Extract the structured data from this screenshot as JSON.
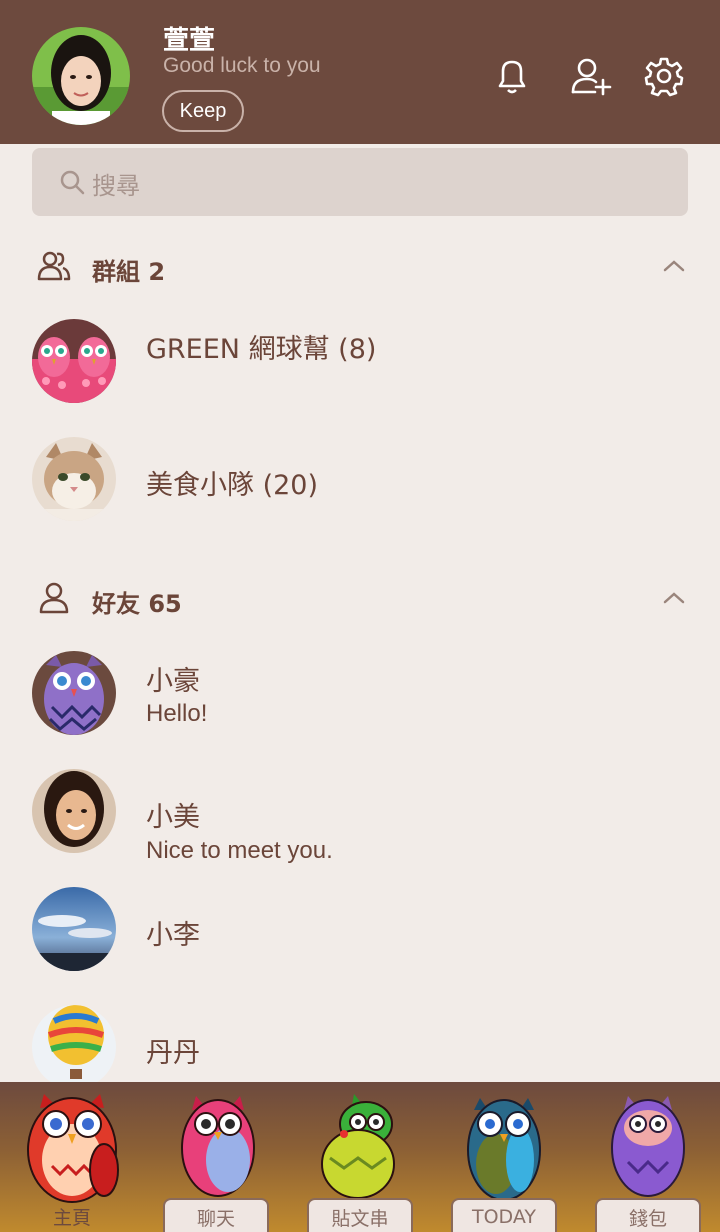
{
  "profile": {
    "name": "萱萱",
    "status": "Good luck to you",
    "keep_label": "Keep"
  },
  "header_icons": [
    "bell-icon",
    "add-friend-icon",
    "settings-gear-icon"
  ],
  "search": {
    "placeholder": "搜尋"
  },
  "groups": {
    "title": "群組 2",
    "items": [
      {
        "name": "GREEN 網球幫 (8)"
      },
      {
        "name": "美食小隊 (20)"
      }
    ]
  },
  "friends": {
    "title": "好友 65",
    "items": [
      {
        "name": "小豪",
        "status": "Hello!"
      },
      {
        "name": "小美",
        "status": "Nice to meet you."
      },
      {
        "name": "小李",
        "status": ""
      },
      {
        "name": "丹丹",
        "status": ""
      }
    ]
  },
  "tabs": [
    {
      "label": "主頁",
      "active": true
    },
    {
      "label": "聊天",
      "active": false
    },
    {
      "label": "貼文串",
      "active": false
    },
    {
      "label": "TODAY",
      "active": false
    },
    {
      "label": "錢包",
      "active": false
    }
  ],
  "colors": {
    "header_bg": "#6d4a3e",
    "page_bg": "#f2ece8",
    "text_brown": "#6b4539",
    "search_bg": "#ddd3ce"
  }
}
